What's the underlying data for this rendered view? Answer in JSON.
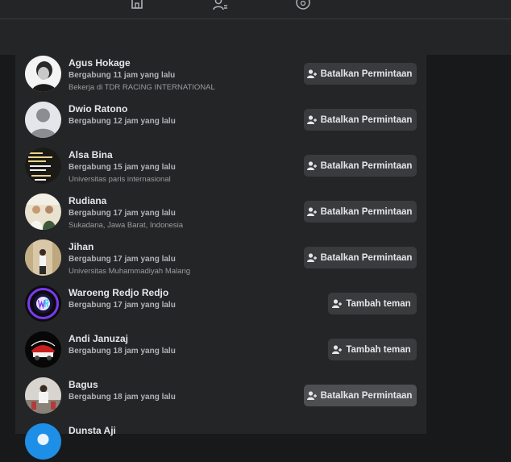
{
  "topnav": {
    "icons": [
      "home-icon",
      "friends-icon",
      "groups-icon"
    ]
  },
  "labels": {
    "cancel_request": "Batalkan Permintaan",
    "add_friend": "Tambah teman"
  },
  "people": [
    {
      "name": "Agus Hokage",
      "joined": "Bergabung 11 jam yang lalu",
      "detail": "Bekerja di TDR RACING INTERNATIONAL",
      "action": "Batalkan Permintaan"
    },
    {
      "name": "Dwio Ratono",
      "joined": "Bergabung 12 jam yang lalu",
      "detail": "",
      "action": "Batalkan Permintaan"
    },
    {
      "name": "Alsa Bina",
      "joined": "Bergabung 15 jam yang lalu",
      "detail": "Universitas paris internasional",
      "action": "Batalkan Permintaan"
    },
    {
      "name": "Rudiana",
      "joined": "Bergabung 17 jam yang lalu",
      "detail": "Sukadana, Jawa Barat, Indonesia",
      "action": "Batalkan Permintaan"
    },
    {
      "name": "Jihan",
      "joined": "Bergabung 17 jam yang lalu",
      "detail": "Universitas Muhammadiyah Malang",
      "action": "Batalkan Permintaan"
    },
    {
      "name": "Waroeng Redjo Redjo",
      "joined": "Bergabung 17 jam yang lalu",
      "detail": "",
      "action": "Tambah teman"
    },
    {
      "name": "Andi Januzaj",
      "joined": "Bergabung 18 jam yang lalu",
      "detail": "",
      "action": "Tambah teman"
    },
    {
      "name": "Bagus",
      "joined": "Bergabung 18 jam yang lalu",
      "detail": "",
      "action": "Batalkan Permintaan"
    },
    {
      "name": "Dunsta Aji",
      "joined": "",
      "detail": "",
      "action": ""
    }
  ],
  "colors": {
    "background": "#18191a",
    "surface": "#242526",
    "button": "#3a3b3c",
    "text_primary": "#e4e6eb",
    "text_secondary": "#b0b3b8"
  }
}
